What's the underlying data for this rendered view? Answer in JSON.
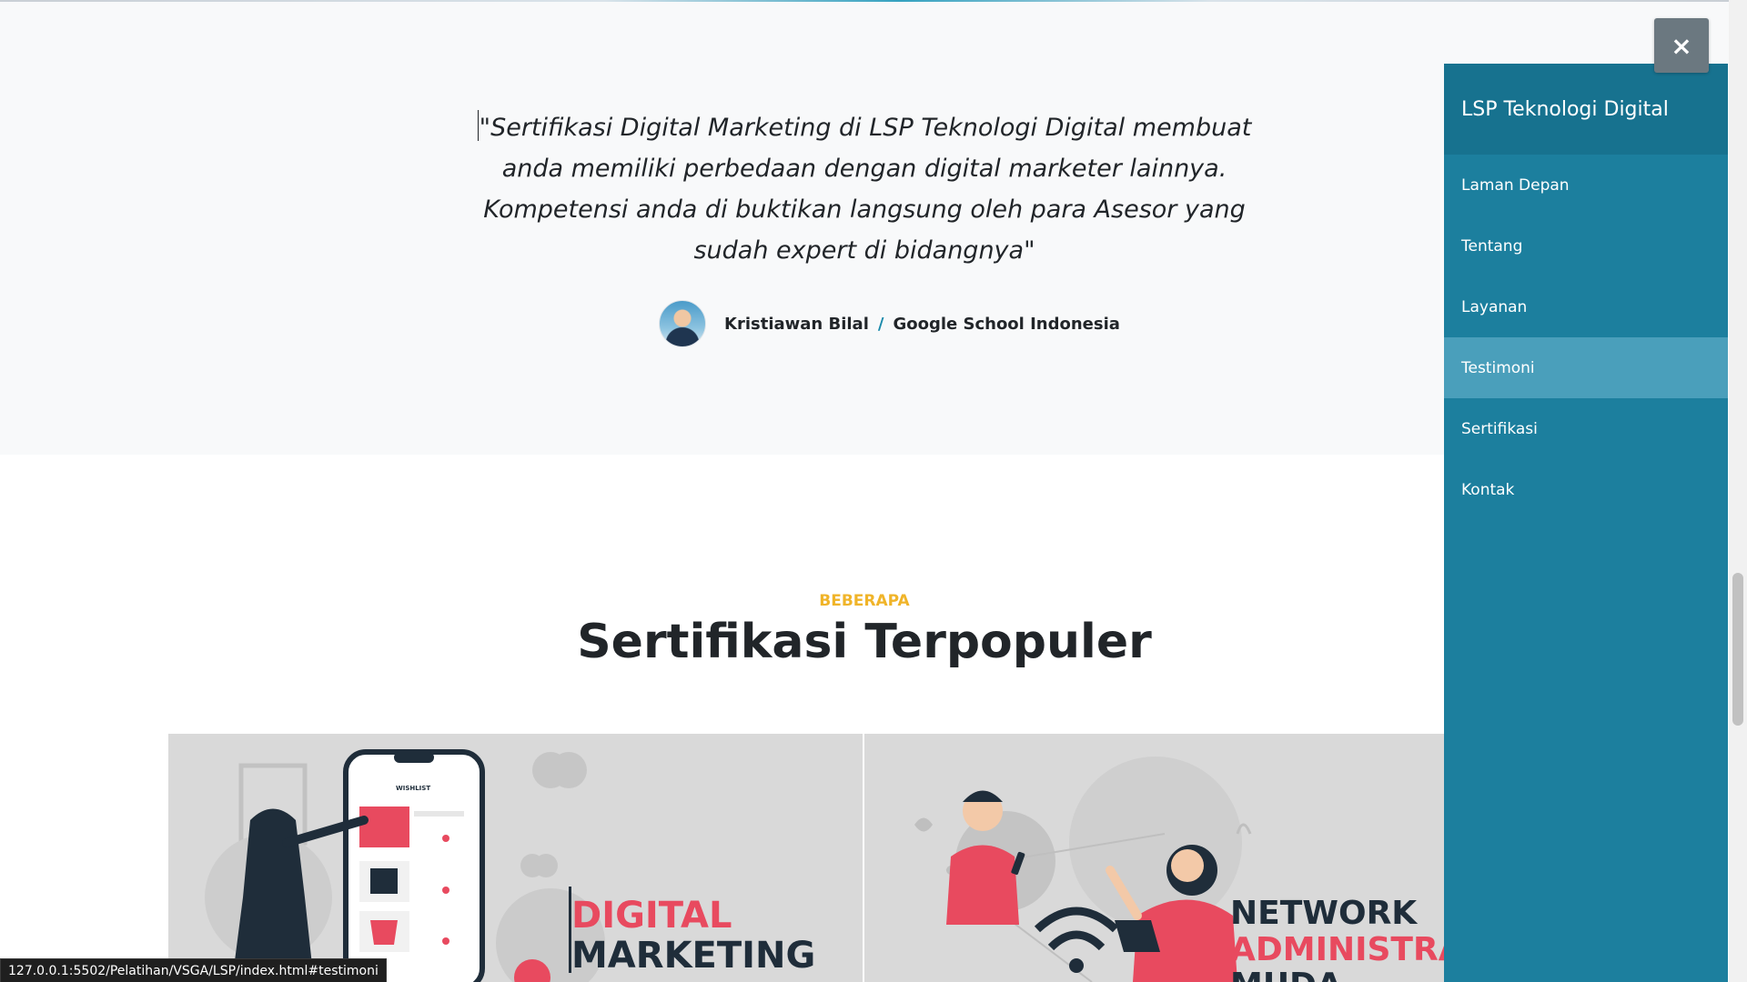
{
  "testimonial": {
    "quote": "\"Sertifikasi Digital Marketing di LSP Teknologi Digital membuat anda memiliki perbedaan dengan digital marketer lainnya. Kompetensi anda di buktikan langsung oleh para Asesor yang sudah expert di bidangnya\"",
    "author_name": "Kristiawan Bilal",
    "separator": "/",
    "author_org": "Google School Indonesia"
  },
  "popular": {
    "eyebrow": "BEBERAPA",
    "title": "Sertifikasi Terpopuler",
    "cards": [
      {
        "line1": "DIGITAL",
        "line2": "MARKETING"
      },
      {
        "line1": "NETWORK",
        "line2": "ADMINISTRAT",
        "line3": "MUDA"
      }
    ]
  },
  "side_menu": {
    "brand": "LSP Teknologi Digital",
    "close_label": "×",
    "items": [
      {
        "label": "Laman Depan",
        "active": false
      },
      {
        "label": "Tentang",
        "active": false
      },
      {
        "label": "Layanan",
        "active": false
      },
      {
        "label": "Testimoni",
        "active": true
      },
      {
        "label": "Sertifikasi",
        "active": false
      },
      {
        "label": "Kontak",
        "active": false
      }
    ]
  },
  "status_bar": {
    "url": "127.0.0.1:5502/Pelatihan/VSGA/LSP/index.html#testimoni"
  },
  "colors": {
    "menu_bg": "#1c7f9e",
    "menu_active": "#4a9fbb",
    "eyebrow": "#f0b429",
    "accent_red": "#e84a5f",
    "dark": "#212529"
  }
}
